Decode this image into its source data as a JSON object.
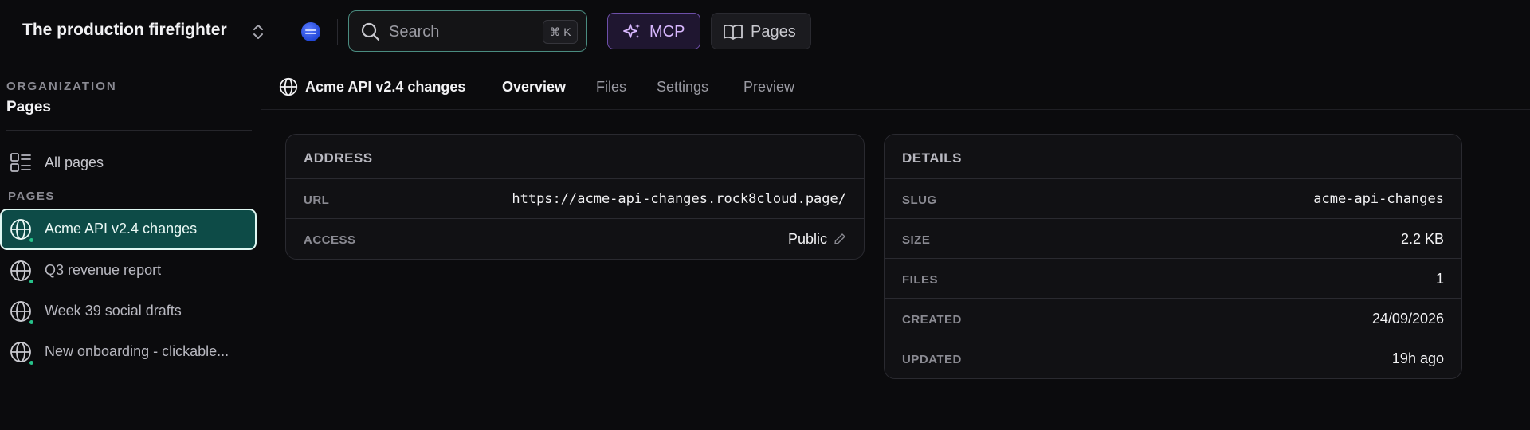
{
  "header": {
    "org_name": "The production firefighter",
    "search_placeholder": "Search",
    "search_shortcut": "⌘ K",
    "mcp_label": "MCP",
    "pages_label": "Pages"
  },
  "sidebar": {
    "eyebrow": "ORGANIZATION",
    "title": "Pages",
    "all_pages_label": "All pages",
    "section_label": "PAGES",
    "items": [
      {
        "label": "Acme API v2.4 changes",
        "active": true
      },
      {
        "label": "Q3 revenue report",
        "active": false
      },
      {
        "label": "Week 39 social drafts",
        "active": false
      },
      {
        "label": "New onboarding - clickable...",
        "active": false
      }
    ]
  },
  "subnav": {
    "page_title": "Acme API v2.4 changes",
    "tabs": [
      "Overview",
      "Files",
      "Settings",
      "Preview"
    ],
    "active_tab": "Overview"
  },
  "address_card": {
    "title": "ADDRESS",
    "rows": [
      {
        "key": "URL",
        "value": "https://acme-api-changes.rock8cloud.page/"
      },
      {
        "key": "ACCESS",
        "value": "Public"
      }
    ]
  },
  "details_card": {
    "title": "DETAILS",
    "rows": [
      {
        "key": "SLUG",
        "value": "acme-api-changes"
      },
      {
        "key": "SIZE",
        "value": "2.2 KB"
      },
      {
        "key": "FILES",
        "value": "1"
      },
      {
        "key": "CREATED",
        "value": "24/09/2026"
      },
      {
        "key": "UPDATED",
        "value": "19h ago"
      }
    ]
  },
  "colors": {
    "accent_teal": "#0d4b47",
    "status_green": "#27c28a",
    "mcp_purple": "#d9b8ff"
  }
}
